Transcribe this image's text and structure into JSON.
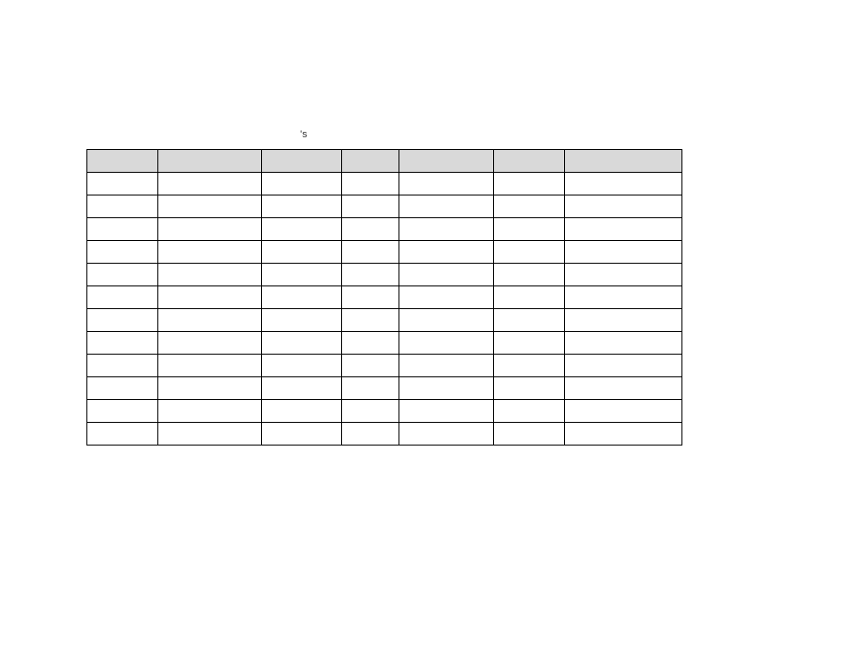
{
  "caption_fragment": "'s",
  "table": {
    "columns": 7,
    "rows": 12,
    "headers": [
      "",
      "",
      "",
      "",
      "",
      "",
      ""
    ],
    "data": [
      [
        "",
        "",
        "",
        "",
        "",
        "",
        ""
      ],
      [
        "",
        "",
        "",
        "",
        "",
        "",
        ""
      ],
      [
        "",
        "",
        "",
        "",
        "",
        "",
        ""
      ],
      [
        "",
        "",
        "",
        "",
        "",
        "",
        ""
      ],
      [
        "",
        "",
        "",
        "",
        "",
        "",
        ""
      ],
      [
        "",
        "",
        "",
        "",
        "",
        "",
        ""
      ],
      [
        "",
        "",
        "",
        "",
        "",
        "",
        ""
      ],
      [
        "",
        "",
        "",
        "",
        "",
        "",
        ""
      ],
      [
        "",
        "",
        "",
        "",
        "",
        "",
        ""
      ],
      [
        "",
        "",
        "",
        "",
        "",
        "",
        ""
      ],
      [
        "",
        "",
        "",
        "",
        "",
        "",
        ""
      ],
      [
        "",
        "",
        "",
        "",
        "",
        "",
        ""
      ]
    ]
  }
}
